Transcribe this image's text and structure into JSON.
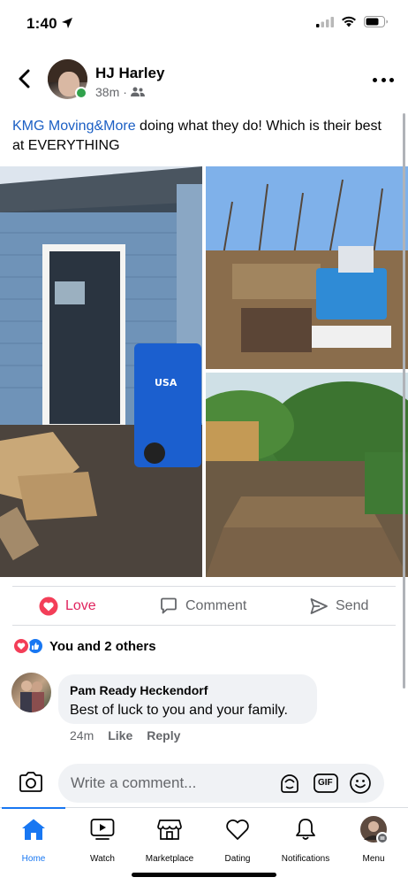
{
  "status_bar": {
    "time": "1:40"
  },
  "post": {
    "poster_name": "HJ Harley",
    "time": "38m",
    "privacy_icon": "friends-icon",
    "mention": "KMG Moving&More",
    "text": " doing what they do! Which is their best at EVERYTHING",
    "photos": [
      {
        "overlay_text": "USA"
      },
      {
        "overlay_text": ""
      },
      {
        "overlay_text": ""
      }
    ]
  },
  "actions": {
    "love_label": "Love",
    "comment_label": "Comment",
    "send_label": "Send"
  },
  "reactions": {
    "text": "You and 2 others"
  },
  "comment": {
    "author": "Pam Ready Heckendorf",
    "text": "Best of luck to you and your family.",
    "time": "24m",
    "like_label": "Like",
    "reply_label": "Reply"
  },
  "composer": {
    "placeholder": "Write a comment...",
    "gif_label": "GIF"
  },
  "tabs": [
    {
      "label": "Home",
      "icon": "home-icon",
      "active": true
    },
    {
      "label": "Watch",
      "icon": "watch-icon",
      "active": false
    },
    {
      "label": "Marketplace",
      "icon": "marketplace-icon",
      "active": false
    },
    {
      "label": "Dating",
      "icon": "dating-icon",
      "active": false
    },
    {
      "label": "Notifications",
      "icon": "bell-icon",
      "active": false
    },
    {
      "label": "Menu",
      "icon": "menu-avatar-icon",
      "active": false
    }
  ],
  "colors": {
    "accent": "#1877f2",
    "love": "#e0245e",
    "mention": "#1b5fc4",
    "online": "#31a24c"
  }
}
